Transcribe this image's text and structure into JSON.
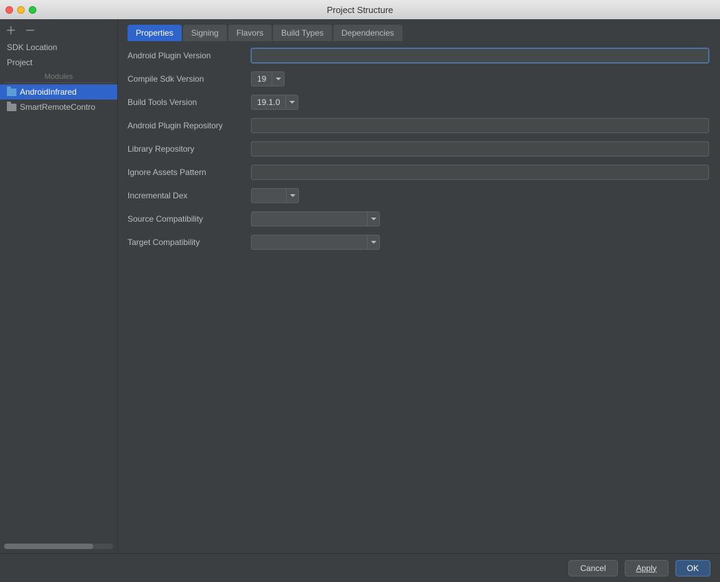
{
  "window": {
    "title": "Project Structure"
  },
  "sidebar": {
    "sdk_location": "SDK Location",
    "project": "Project",
    "modules_header": "Modules",
    "modules": [
      {
        "label": "AndroidInfrared",
        "selected": true
      },
      {
        "label": "SmartRemoteContro",
        "selected": false
      }
    ]
  },
  "tabs": [
    {
      "label": "Properties",
      "active": true
    },
    {
      "label": "Signing",
      "active": false
    },
    {
      "label": "Flavors",
      "active": false
    },
    {
      "label": "Build Types",
      "active": false
    },
    {
      "label": "Dependencies",
      "active": false
    }
  ],
  "form": {
    "android_plugin_version": {
      "label": "Android Plugin Version",
      "value": ""
    },
    "compile_sdk_version": {
      "label": "Compile Sdk Version",
      "value": "19"
    },
    "build_tools_version": {
      "label": "Build Tools Version",
      "value": "19.1.0"
    },
    "android_plugin_repository": {
      "label": "Android Plugin Repository",
      "value": ""
    },
    "library_repository": {
      "label": "Library Repository",
      "value": ""
    },
    "ignore_assets_pattern": {
      "label": "Ignore Assets Pattern",
      "value": ""
    },
    "incremental_dex": {
      "label": "Incremental Dex",
      "value": ""
    },
    "source_compat": {
      "label": "Source Compatibility",
      "value": ""
    },
    "target_compat": {
      "label": "Target Compatibility",
      "value": ""
    }
  },
  "footer": {
    "cancel": "Cancel",
    "apply": "Apply",
    "ok": "OK"
  }
}
